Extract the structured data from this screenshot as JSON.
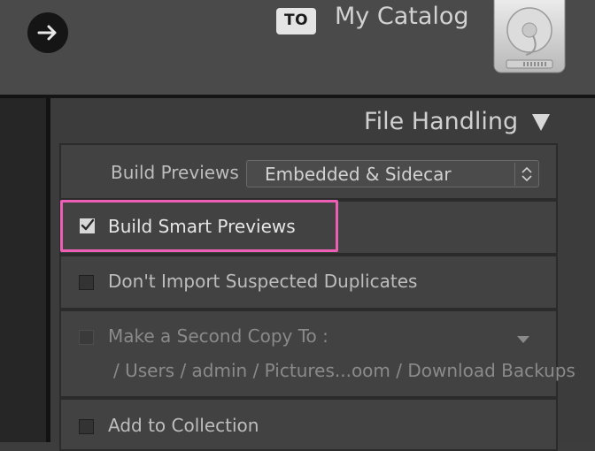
{
  "header": {
    "to_label": "TO",
    "catalog_name": "My Catalog"
  },
  "file_handling": {
    "title": "File Handling",
    "build_previews_label": "Build Previews",
    "build_previews_value": "Embedded & Sidecar",
    "build_smart_previews_label": "Build Smart Previews",
    "build_smart_previews_checked": true,
    "dont_import_duplicates_label": "Don't Import Suspected Duplicates",
    "dont_import_duplicates_checked": false,
    "second_copy_label": "Make a Second Copy To :",
    "second_copy_path": "/ Users / admin / Pictures...oom / Download Backups",
    "second_copy_checked": false,
    "add_to_collection_label": "Add to Collection",
    "add_to_collection_checked": false
  },
  "colors": {
    "highlight": "#ec5fb5"
  }
}
